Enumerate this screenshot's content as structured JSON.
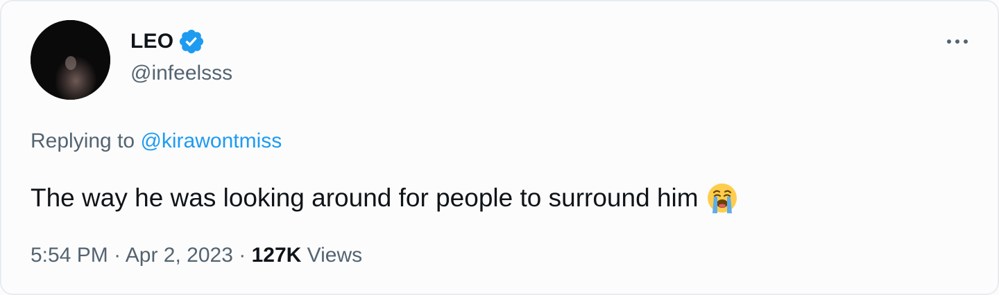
{
  "tweet": {
    "author": {
      "display_name": "LEO",
      "handle": "@infeelsss",
      "verified": true,
      "verified_badge_icon": "verified-check-icon",
      "avatar_image": "dark profile photo"
    },
    "more_icon": "more-horizontal-icon",
    "replying_prefix": "Replying to",
    "replying_to": "@kirawontmiss",
    "text": "The way he was looking around for people to surround him",
    "emoji": "loudly-crying-face-emoji",
    "time": "5:54 PM",
    "separator": "·",
    "date": "Apr 2, 2023",
    "views_count": "127K",
    "views_label": "Views"
  },
  "colors": {
    "background": "#fdfcfd",
    "text_primary": "#0f1419",
    "text_secondary": "#536471",
    "link": "#1d9bf0",
    "verified": "#1d9bf0"
  }
}
